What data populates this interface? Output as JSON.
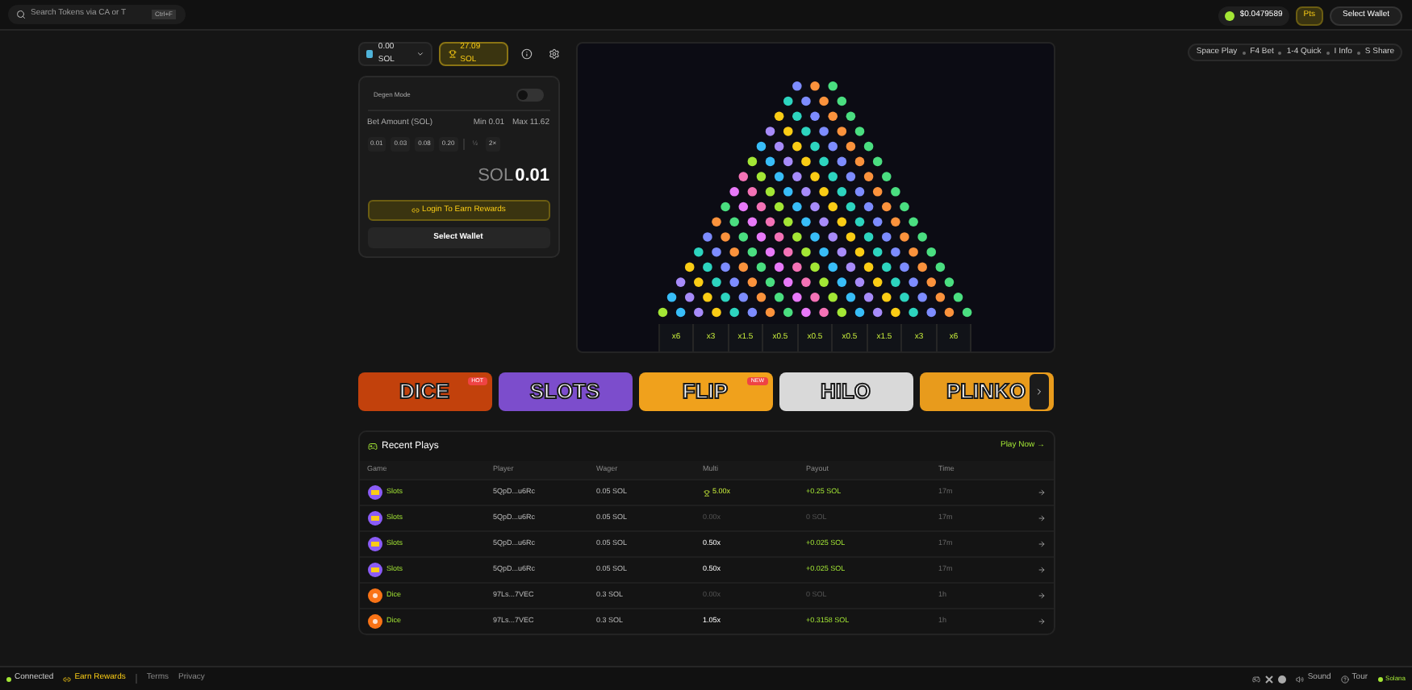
{
  "search": {
    "placeholder": "Search Tokens via CA or T",
    "shortcut": "Ctrl+F"
  },
  "header": {
    "balance": "$0.0479589",
    "badge": "Pts",
    "wallet_button": "Select Wallet"
  },
  "hotkeys": [
    "Space Play",
    "F4 Bet",
    "1-4 Quick",
    "I Info",
    "S Share"
  ],
  "toolbar": {
    "token": "0.00 SOL",
    "prize": "27.09 SOL"
  },
  "bet_panel": {
    "degen_label": "Degen Mode",
    "degen_on": false,
    "bet_label": "Bet Amount (SOL)",
    "min": "Min 0.01",
    "max": "Max 11.62",
    "quick": [
      "0.01",
      "0.03",
      "0.08",
      "0.20"
    ],
    "half": "½",
    "double": "2×",
    "currency": "SOL",
    "amount": "0.01",
    "login_button": "Login To Earn Rewards",
    "wallet_button": "Select Wallet"
  },
  "multipliers": [
    "x6",
    "x3",
    "x1.5",
    "x0.5",
    "x0.5",
    "x0.5",
    "x1.5",
    "x3",
    "x6"
  ],
  "games": [
    {
      "title": "DICE",
      "badge": "HOT",
      "color": "#c2410c"
    },
    {
      "title": "SLOTS",
      "color": "#7c4dcc"
    },
    {
      "title": "FLIP",
      "badge": "NEW",
      "color": "#f0a11c"
    },
    {
      "title": "HILO",
      "color": "#d9d9d9"
    },
    {
      "title": "PLINKO",
      "color": "#e89b1c"
    }
  ],
  "recent_plays": {
    "title": "Recent Plays",
    "link": "Play Now →",
    "columns": [
      "Game",
      "Player",
      "Wager",
      "Multi",
      "Payout",
      "Time"
    ],
    "rows": [
      {
        "game": "Slots",
        "kind": "slots",
        "player": "5QpD...u6Rc",
        "wager": "0.05 SOL",
        "multi": "5.00x",
        "won": true,
        "top_win": true,
        "payout": "+0.25 SOL",
        "time": "17m"
      },
      {
        "game": "Slots",
        "kind": "slots",
        "player": "5QpD...u6Rc",
        "wager": "0.05 SOL",
        "multi": "0.00x",
        "won": false,
        "top_win": false,
        "payout": "0 SOL",
        "time": "17m"
      },
      {
        "game": "Slots",
        "kind": "slots",
        "player": "5QpD...u6Rc",
        "wager": "0.05 SOL",
        "multi": "0.50x",
        "won": true,
        "top_win": false,
        "payout": "+0.025 SOL",
        "time": "17m"
      },
      {
        "game": "Slots",
        "kind": "slots",
        "player": "5QpD...u6Rc",
        "wager": "0.05 SOL",
        "multi": "0.50x",
        "won": true,
        "top_win": false,
        "payout": "+0.025 SOL",
        "time": "17m"
      },
      {
        "game": "Dice",
        "kind": "dice",
        "player": "97Ls...7VEC",
        "wager": "0.3 SOL",
        "multi": "0.00x",
        "won": false,
        "top_win": false,
        "payout": "0 SOL",
        "time": "1h"
      },
      {
        "game": "Dice",
        "kind": "dice",
        "player": "97Ls...7VEC",
        "wager": "0.3 SOL",
        "multi": "1.05x",
        "won": true,
        "top_win": false,
        "payout": "+0.3158 SOL",
        "time": "1h"
      }
    ]
  },
  "footer": {
    "status": "Connected",
    "rewards": "Earn Rewards",
    "links": [
      "Terms",
      "Privacy"
    ],
    "sound": "Sound",
    "tour": "Tour",
    "network": "Solana"
  }
}
